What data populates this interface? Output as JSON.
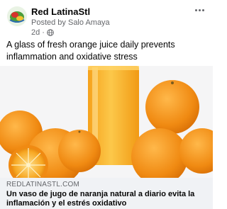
{
  "post": {
    "page_name": "Red LatinaStl",
    "posted_by": "Posted by Salo Amaya",
    "time": "2d",
    "separator": "·",
    "audience_icon": "globe-icon",
    "more_icon": "more-options-icon",
    "caption": "A glass of fresh orange juice daily prevents inflammation and oxidative stress"
  },
  "link_preview": {
    "domain": "REDLATINASTL.COM",
    "title": "Un vaso de jugo de naranja natural a diario evita la inflamación y el estrés oxidativo",
    "image": "orange-juice-and-oranges-image"
  },
  "colors": {
    "text_primary": "#050505",
    "text_secondary": "#65676b",
    "link_bg": "#f0f2f5",
    "orange": "#f39a1e",
    "juice": "#f7b32b"
  }
}
